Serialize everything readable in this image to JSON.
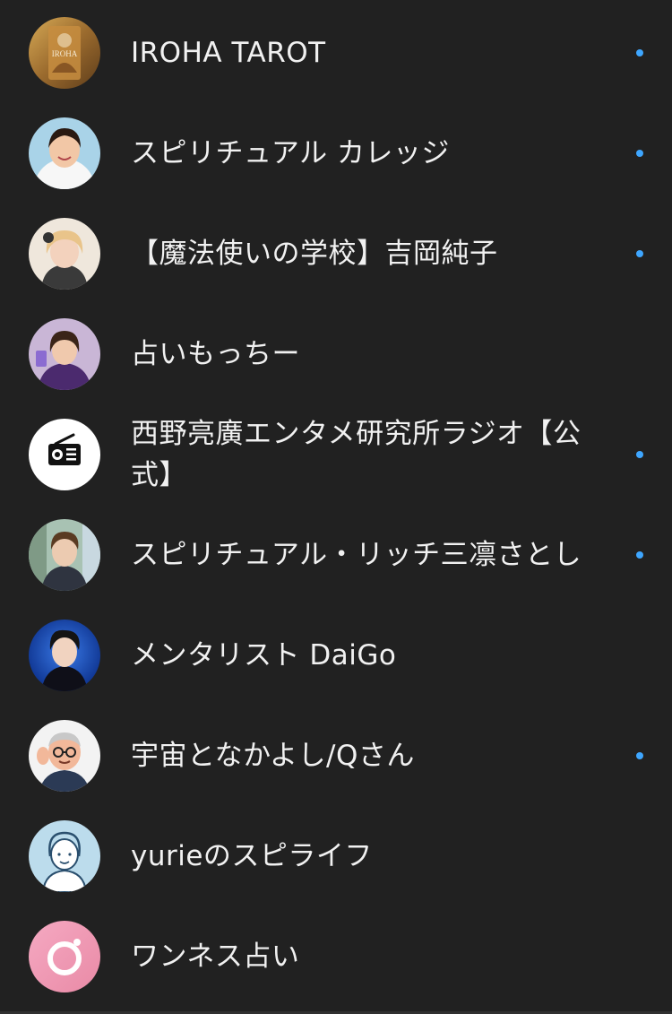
{
  "subscriptions": [
    {
      "name": "IROHA TAROT",
      "avatar": "iroha-tarot-avatar",
      "new_content": true,
      "avatar_text": "IROHA",
      "avatar_color": "#b7893a"
    },
    {
      "name": "スピリチュアル カレッジ",
      "avatar": "person-avatar",
      "new_content": true,
      "avatar_color": "#a9d3e8"
    },
    {
      "name": "【魔法使いの学校】吉岡純子",
      "avatar": "person-avatar",
      "new_content": true,
      "avatar_color": "#e6dccb"
    },
    {
      "name": "占いもっちー",
      "avatar": "person-avatar",
      "new_content": false,
      "avatar_color": "#5a3f6b"
    },
    {
      "name": "西野亮廣エンタメ研究所ラジオ【公式】",
      "avatar": "radio-icon",
      "new_content": true,
      "avatar_color": "#ffffff"
    },
    {
      "name": "スピリチュアル・リッチ三凛さとし",
      "avatar": "person-avatar",
      "new_content": true,
      "avatar_color": "#9bb7a2"
    },
    {
      "name": "メンタリスト DaiGo",
      "avatar": "person-avatar",
      "new_content": false,
      "avatar_color": "#1f4fa8"
    },
    {
      "name": "宇宙となかよし/Qさん",
      "avatar": "cartoon-avatar",
      "new_content": true,
      "avatar_color": "#f3f3f3"
    },
    {
      "name": "yurieのスピライフ",
      "avatar": "illustrated-person-avatar",
      "new_content": false,
      "avatar_color": "#bcdcec"
    },
    {
      "name": "ワンネス占い",
      "avatar": "ring-logo-icon",
      "new_content": false,
      "avatar_color": "#ef9bb3"
    }
  ],
  "colors": {
    "background": "#212121",
    "text": "#f1f1f1",
    "new_content_dot": "#3ea6ff"
  }
}
